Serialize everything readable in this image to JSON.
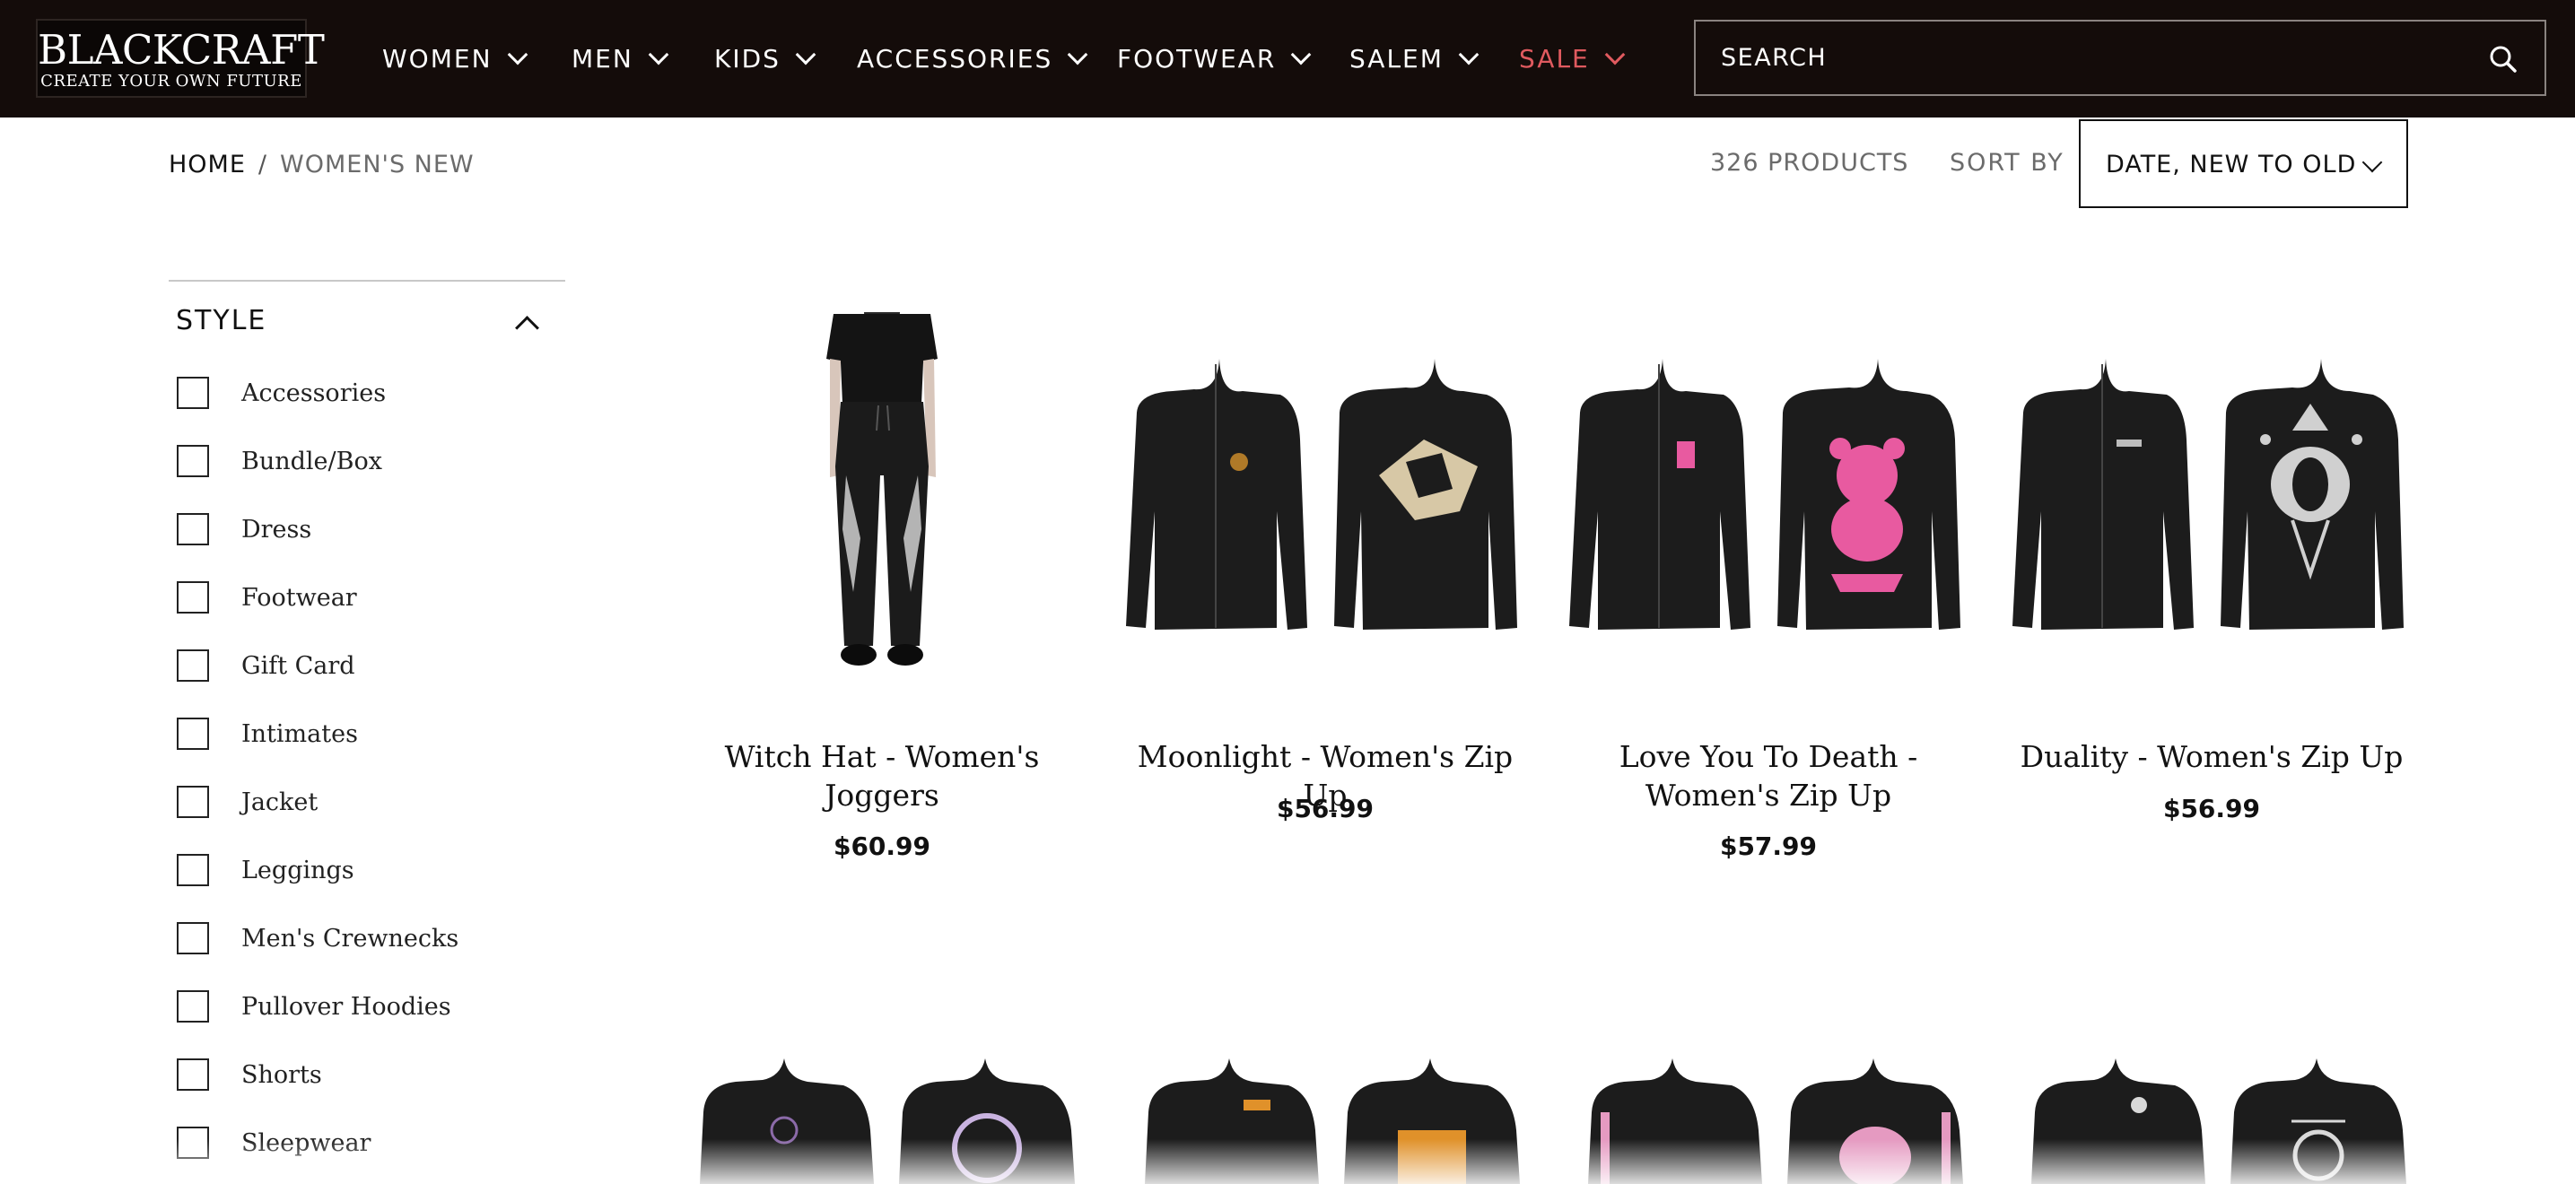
{
  "header": {
    "logo": {
      "word": "BLACKCRAFT",
      "tagline": "CREATE YOUR OWN FUTURE"
    },
    "nav": [
      {
        "label": "WOMEN"
      },
      {
        "label": "MEN"
      },
      {
        "label": "KIDS"
      },
      {
        "label": "ACCESSORIES"
      },
      {
        "label": "FOOTWEAR"
      },
      {
        "label": "SALEM"
      },
      {
        "label": "SALE"
      }
    ],
    "search": {
      "placeholder": "SEARCH",
      "icon": "magnifier"
    },
    "colors": {
      "bar": "#140c0a",
      "sale": "#e05a5f"
    }
  },
  "breadcrumb": {
    "home": "HOME",
    "separator": "/",
    "current": "WOMEN'S NEW"
  },
  "toolbar": {
    "count": "326 PRODUCTS",
    "sort_label": "SORT BY",
    "sort_value": "DATE, NEW TO OLD"
  },
  "sidebar": {
    "title": "STYLE",
    "options": [
      {
        "label": "Accessories",
        "checked": false
      },
      {
        "label": "Bundle/Box",
        "checked": false
      },
      {
        "label": "Dress",
        "checked": false
      },
      {
        "label": "Footwear",
        "checked": false
      },
      {
        "label": "Gift Card",
        "checked": false
      },
      {
        "label": "Intimates",
        "checked": false
      },
      {
        "label": "Jacket",
        "checked": false
      },
      {
        "label": "Leggings",
        "checked": false
      },
      {
        "label": "Men's Crewnecks",
        "checked": false
      },
      {
        "label": "Pullover Hoodies",
        "checked": false
      },
      {
        "label": "Shorts",
        "checked": false
      },
      {
        "label": "Sleepwear",
        "checked": false
      }
    ]
  },
  "products": [
    {
      "name_line1": "Witch Hat - Women's",
      "name_line2": "Joggers",
      "price": "$60.99"
    },
    {
      "name_line1": "Moonlight - Women's Zip Up",
      "name_line2": "",
      "price": "$56.99"
    },
    {
      "name_line1": "Love You To Death -",
      "name_line2": "Women's Zip Up",
      "price": "$57.99"
    },
    {
      "name_line1": "Duality - Women's Zip Up",
      "name_line2": "",
      "price": "$56.99"
    }
  ]
}
